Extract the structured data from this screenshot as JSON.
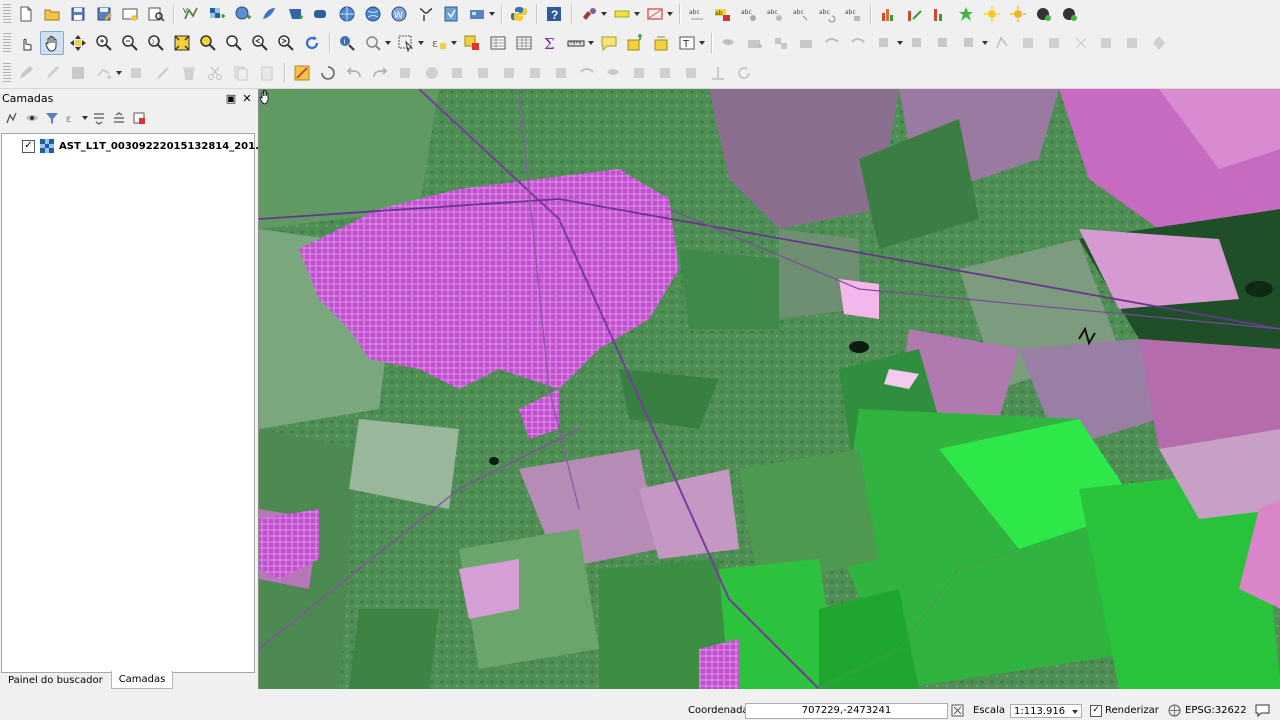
{
  "toolbar": {
    "row1": [
      "new-project",
      "open-project",
      "save-project",
      "save-as",
      "new-print-layout",
      "layout-manager",
      "add-vector",
      "add-raster",
      "add-wms",
      "add-spatialite",
      "add-postgis",
      "add-wcs",
      "add-wfs",
      "add-delimited",
      "add-virtual",
      "add-mesh",
      "new-layer",
      "python-console",
      "help",
      "style-manager",
      "highlight",
      "label-tool",
      "labels-1",
      "labels-2",
      "labels-3",
      "labels-4",
      "labels-5",
      "labels-6",
      "labels-7",
      "plugin-1",
      "plugin-2",
      "plugin-3",
      "plugin-4",
      "plugin-5",
      "plugin-6",
      "plugin-7"
    ],
    "row2_active": "pan-map"
  },
  "layers_panel": {
    "title": "Camadas",
    "layer": {
      "name": "AST_L1T_00309222015132814_201...",
      "checked": true
    },
    "tabs": [
      "Painel do buscador",
      "Camadas"
    ],
    "active_tab": "Camadas"
  },
  "status_bar": {
    "coordinate_label": "Coordenada",
    "coordinate_value": "707229,-2473241",
    "scale_label": "Escala",
    "scale_value": "1:113.916",
    "render_label": "Renderizar",
    "render_checked": true,
    "crs": "EPSG:32622"
  },
  "colors": {
    "urban": "#c24fd0",
    "vegetation": "#2fa844",
    "bright_vegetation": "#2ee84a",
    "bare_soil": "#d98bcf"
  }
}
